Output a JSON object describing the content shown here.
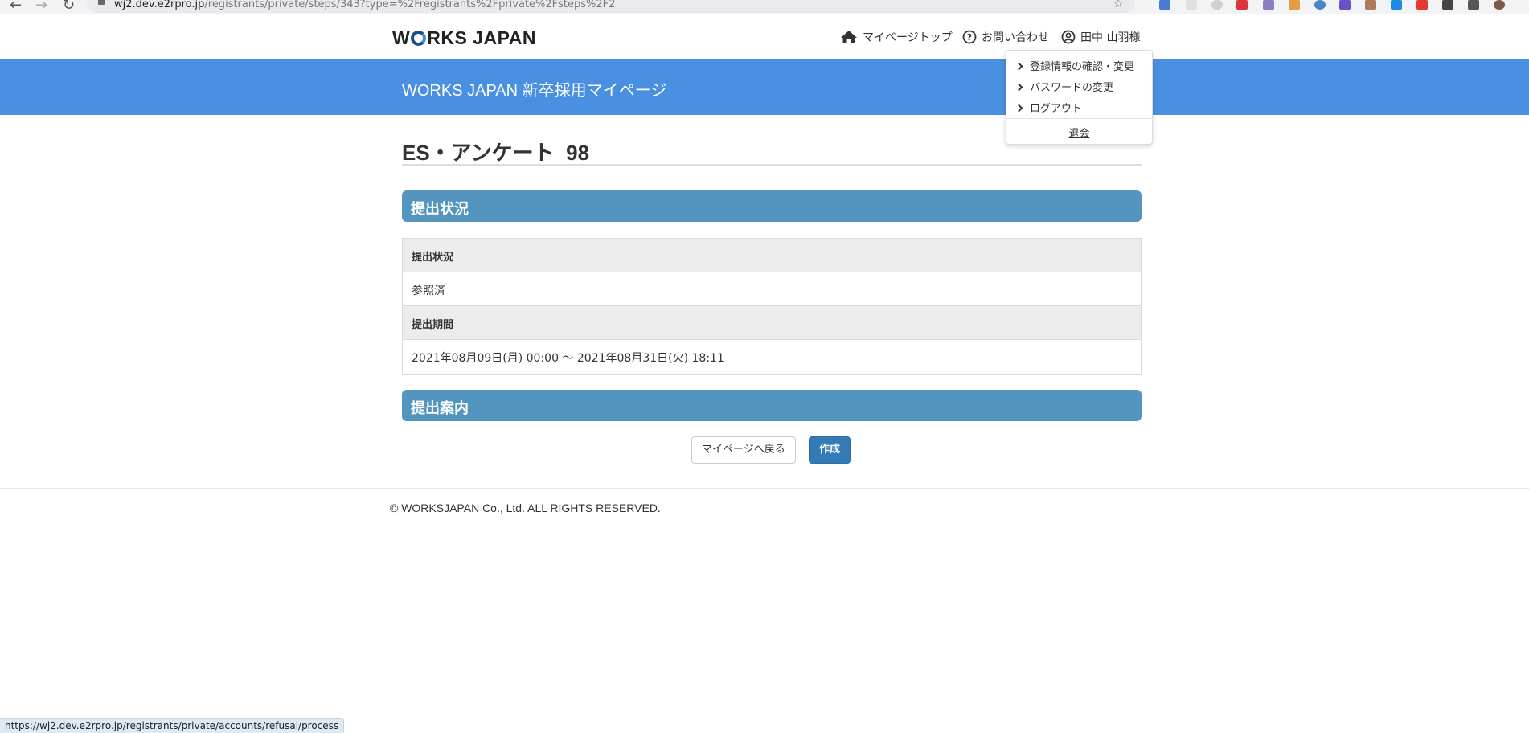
{
  "browser": {
    "url_host": "wj2.dev.e2rpro.jp",
    "url_path": "/registrants/private/steps/343?type=%2Fregistrants%2Fprivate%2Fsteps%2F2",
    "status_url": "https://wj2.dev.e2rpro.jp/registrants/private/accounts/refusal/process"
  },
  "header": {
    "logo_part1": "W",
    "logo_part2": "RKS JAPAN",
    "nav_top": "マイページトップ",
    "nav_contact": "お問い合わせ",
    "nav_user": "田中 山羽様"
  },
  "banner": {
    "title": "WORKS JAPAN 新卒採用マイページ"
  },
  "dropdown": {
    "items": [
      "登録情報の確認・変更",
      "パスワードの変更",
      "ログアウト"
    ],
    "withdraw": "退会"
  },
  "main": {
    "page_title": "ES・アンケート_98",
    "section1_title": "提出状況",
    "table": {
      "status_label": "提出状況",
      "status_value": "参照済",
      "period_label": "提出期間",
      "period_value": "2021年08月09日(月) 00:00 〜 2021年08月31日(火) 18:11"
    },
    "section2_title": "提出案内",
    "back_button": "マイページへ戻る",
    "create_button": "作成"
  },
  "footer": {
    "copyright": "© WORKSJAPAN Co., Ltd. ALL RIGHTS RESERVED."
  },
  "colors": {
    "banner": "#4a90e2",
    "section_bar": "#5395bf",
    "primary_button": "#337ab7"
  }
}
